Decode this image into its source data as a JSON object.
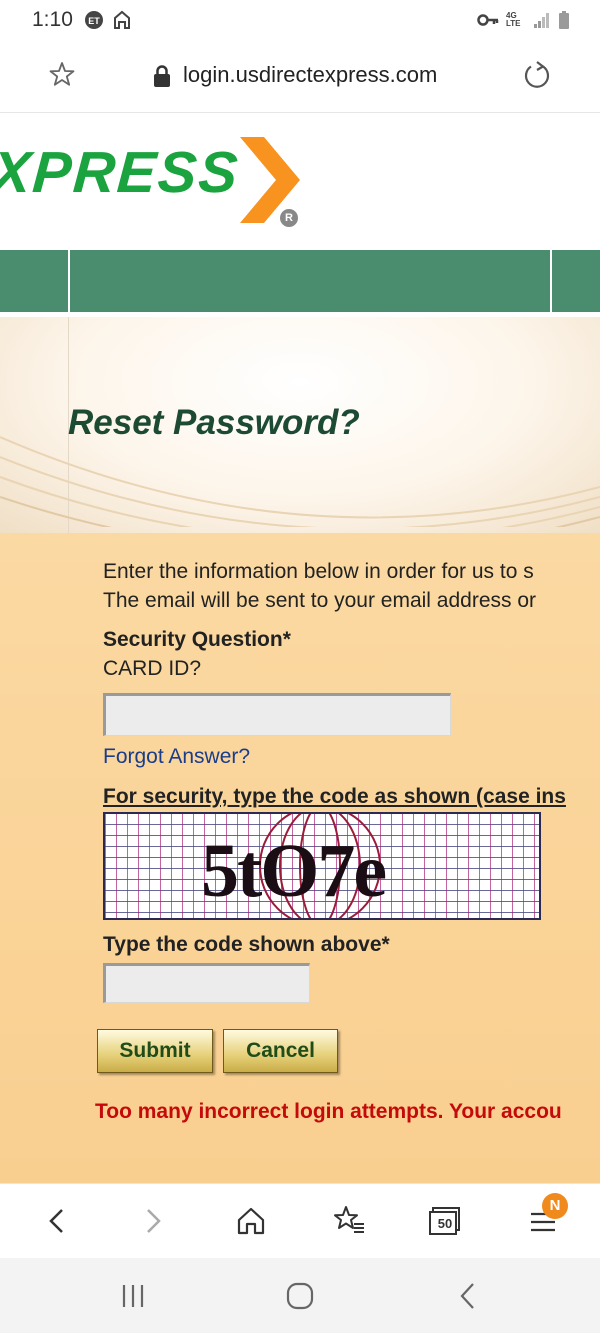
{
  "status_bar": {
    "time": "1:10",
    "network": "4G LTE"
  },
  "browser": {
    "url": "login.usdirectexpress.com"
  },
  "logo": {
    "text": "XPRESS",
    "registered": "R"
  },
  "page": {
    "title": "Reset Password?",
    "intro_line1": "Enter the information below in order for us to s",
    "intro_line2": "The email will be sent to your email address or",
    "security_question_label": "Security Question*",
    "security_question": "CARD ID?",
    "answer_value": "",
    "forgot_answer": "Forgot Answer?",
    "captcha_instruction": "For security, type the code as shown (case ins",
    "captcha_text": "5tO7e",
    "code_label": "Type the code shown above*",
    "code_value": "",
    "submit_label": "Submit",
    "cancel_label": "Cancel",
    "error": "Too many incorrect login attempts. Your accou"
  },
  "bottom_bar": {
    "tabs_count": "50",
    "menu_badge": "N"
  },
  "colors": {
    "brand_green": "#1aa33f",
    "brand_orange": "#f7931e",
    "bar_green": "#4a8d6e",
    "error_red": "#c40a0a",
    "link_blue": "#1a3d8a"
  }
}
